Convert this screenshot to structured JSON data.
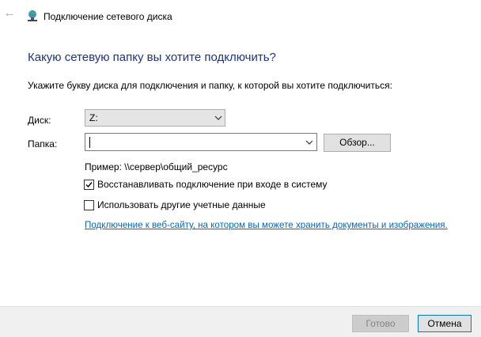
{
  "window": {
    "title": "Подключение сетевого диска",
    "back_icon": "back-arrow-icon",
    "app_icon": "network-drive-icon"
  },
  "main": {
    "heading": "Какую сетевую папку вы хотите подключить?",
    "instruction": "Укажите букву диска для подключения и папку, к которой вы хотите подключиться:",
    "disk_label": "Диск:",
    "disk_value": "Z:",
    "folder_label": "Папка:",
    "folder_value": "",
    "browse_label": "Обзор...",
    "example": "Пример: \\\\сервер\\общий_ресурс",
    "reconnect_label": "Восстанавливать подключение при входе в систему",
    "reconnect_checked": true,
    "other_credentials_label": "Использовать другие учетные данные",
    "other_credentials_checked": false,
    "website_link": "Подключение к веб-сайту, на котором вы можете хранить документы и изображения."
  },
  "footer": {
    "done_label": "Готово",
    "cancel_label": "Отмена"
  },
  "colors": {
    "heading": "#1e3287",
    "link": "#0066cc",
    "cancel_border": "#0078d7"
  }
}
